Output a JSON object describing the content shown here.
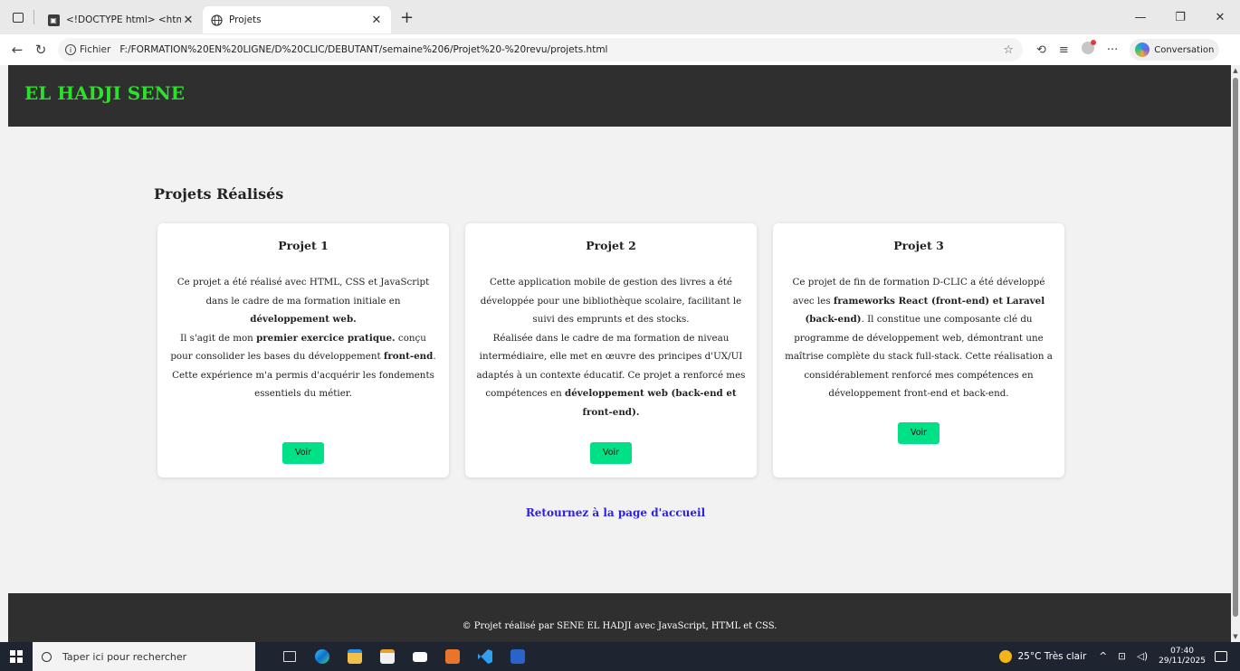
{
  "browser": {
    "tabs": [
      {
        "title": "<!DOCTYPE html> <html lang=\"f",
        "active": false
      },
      {
        "title": "Projets",
        "active": true
      }
    ],
    "new_tab_label": "+",
    "url_scheme_label": "Fichier",
    "url": "F:/FORMATION%20EN%20LIGNE/D%20CLIC/DEBUTANT/semaine%206/Projet%20-%20revu/projets.html",
    "copilot_label": "Conversation"
  },
  "site": {
    "title": "EL HADJI SENE"
  },
  "main": {
    "section_title": "Projets Réalisés",
    "cards": [
      {
        "title": "Projet 1",
        "desc_parts": [
          "Ce projet a été réalisé avec HTML, CSS et JavaScript dans le cadre de ma formation initiale en ",
          "développement web.",
          "Il s'agit de mon ",
          "premier exercice pratique.",
          " conçu pour consolider les bases du développement ",
          "front-end",
          ".",
          "Cette expérience m'a permis d'acquérir les fondements essentiels du métier."
        ],
        "button_label": "Voir"
      },
      {
        "title": "Projet 2",
        "desc_parts": [
          "Cette application mobile de gestion des livres a été développée pour une bibliothèque scolaire, facilitant le suivi des emprunts et des stocks.",
          "Réalisée dans le cadre de ma formation de niveau intermédiaire, elle met en œuvre des principes d'UX/UI adaptés à un contexte éducatif. Ce projet a renforcé mes compétences en ",
          "développement web (back-end et front-end)."
        ],
        "button_label": "Voir"
      },
      {
        "title": "Projet 3",
        "desc_parts": [
          "Ce projet de fin de formation D-CLIC a été développé avec les ",
          "frameworks React (front-end) et Laravel (back-end)",
          ". Il constitue une composante clé du programme de développement web, démontrant une maîtrise complète du stack full-stack. Cette réalisation a considérablement renforcé mes compétences en développement front-end et back-end."
        ],
        "button_label": "Voir"
      }
    ],
    "back_link": "Retournez à la page d'accueil"
  },
  "footer": {
    "text": "© Projet réalisé par SENE EL HADJI avec JavaScript, HTML et CSS."
  },
  "taskbar": {
    "search_placeholder": "Taper ici pour rechercher",
    "weather": "25°C  Très clair",
    "time": "07:40",
    "date": "29/11/2025"
  }
}
